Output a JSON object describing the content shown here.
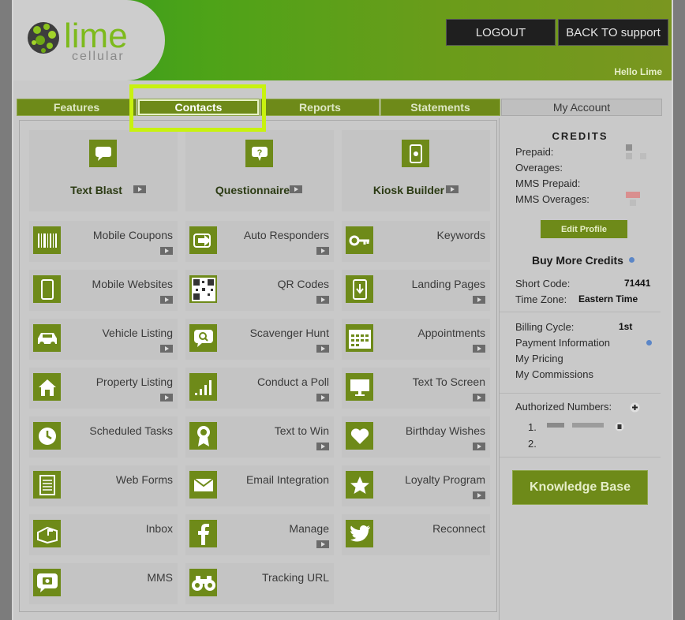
{
  "header": {
    "logo_text": "lime",
    "logo_sub": "cellular",
    "logout_label": "LOGOUT",
    "back_label": "BACK TO support",
    "greeting": "Hello Lime"
  },
  "tabs": [
    {
      "label": "Features",
      "active": false
    },
    {
      "label": "Contacts",
      "active": true
    },
    {
      "label": "Reports",
      "active": false
    },
    {
      "label": "Statements",
      "active": false
    },
    {
      "label": "My Account",
      "active": false
    }
  ],
  "top_tiles": [
    {
      "label": "Text Blast",
      "icon": "speech-bubble-icon"
    },
    {
      "label": "Questionnaire",
      "icon": "question-bubble-icon"
    },
    {
      "label": "Kiosk Builder",
      "icon": "tablet-touch-icon"
    }
  ],
  "features": [
    {
      "label": "Mobile Coupons",
      "icon": "barcode-icon",
      "video": true
    },
    {
      "label": "Auto Responders",
      "icon": "arrow-right-icon",
      "video": true
    },
    {
      "label": "Keywords",
      "icon": "key-icon",
      "video": false
    },
    {
      "label": "Mobile Websites",
      "icon": "smartphone-icon",
      "video": true
    },
    {
      "label": "QR Codes",
      "icon": "qr-code-icon",
      "video": true
    },
    {
      "label": "Landing Pages",
      "icon": "download-phone-icon",
      "video": true
    },
    {
      "label": "Vehicle Listing",
      "icon": "car-icon",
      "video": true
    },
    {
      "label": "Scavenger Hunt",
      "icon": "search-bubble-icon",
      "video": true
    },
    {
      "label": "Appointments",
      "icon": "calendar-icon",
      "video": true
    },
    {
      "label": "Property Listing",
      "icon": "house-icon",
      "video": true
    },
    {
      "label": "Conduct a Poll",
      "icon": "bar-chart-icon",
      "video": true
    },
    {
      "label": "Text To Screen",
      "icon": "monitor-icon",
      "video": true
    },
    {
      "label": "Scheduled Tasks",
      "icon": "clock-icon",
      "video": false
    },
    {
      "label": "Text to Win",
      "icon": "award-ribbon-icon",
      "video": true
    },
    {
      "label": "Birthday Wishes",
      "icon": "heart-icon",
      "video": true
    },
    {
      "label": "Web Forms",
      "icon": "form-document-icon",
      "video": false
    },
    {
      "label": "Email Integration",
      "icon": "envelope-icon",
      "video": false
    },
    {
      "label": "Loyalty Program",
      "icon": "star-icon",
      "video": true
    },
    {
      "label": "Inbox",
      "icon": "mailbox-icon",
      "video": false
    },
    {
      "label": "Manage",
      "icon": "facebook-icon",
      "video": true
    },
    {
      "label": "Reconnect",
      "icon": "twitter-icon",
      "video": false
    },
    {
      "label": "MMS",
      "icon": "camera-bubble-icon",
      "video": false
    },
    {
      "label": "Tracking URL",
      "icon": "binoculars-icon",
      "video": false
    }
  ],
  "sidebar": {
    "credits_title": "CREDITS",
    "prepaid_label": "Prepaid:",
    "overages_label": "Overages:",
    "mms_prepaid_label": "MMS Prepaid:",
    "mms_overages_label": "MMS Overages:",
    "edit_profile_label": "Edit Profile",
    "buy_credits_label": "Buy More Credits",
    "short_code_label": "Short Code:",
    "short_code_value": "71441",
    "time_zone_label": "Time Zone:",
    "time_zone_value": "Eastern Time",
    "billing_cycle_label": "Billing Cycle:",
    "billing_cycle_value": "1st",
    "payment_info_label": "Payment Information",
    "my_pricing_label": "My Pricing",
    "my_commissions_label": "My Commissions",
    "authorized_label": "Authorized Numbers:",
    "authorized_items": [
      "1.",
      "2."
    ],
    "knowledge_base_label": "Knowledge Base"
  },
  "colors": {
    "accent": "#6e8a19",
    "highlight": "#c8f20f",
    "header_start": "#2f9a1f",
    "header_end": "#7a9620"
  }
}
